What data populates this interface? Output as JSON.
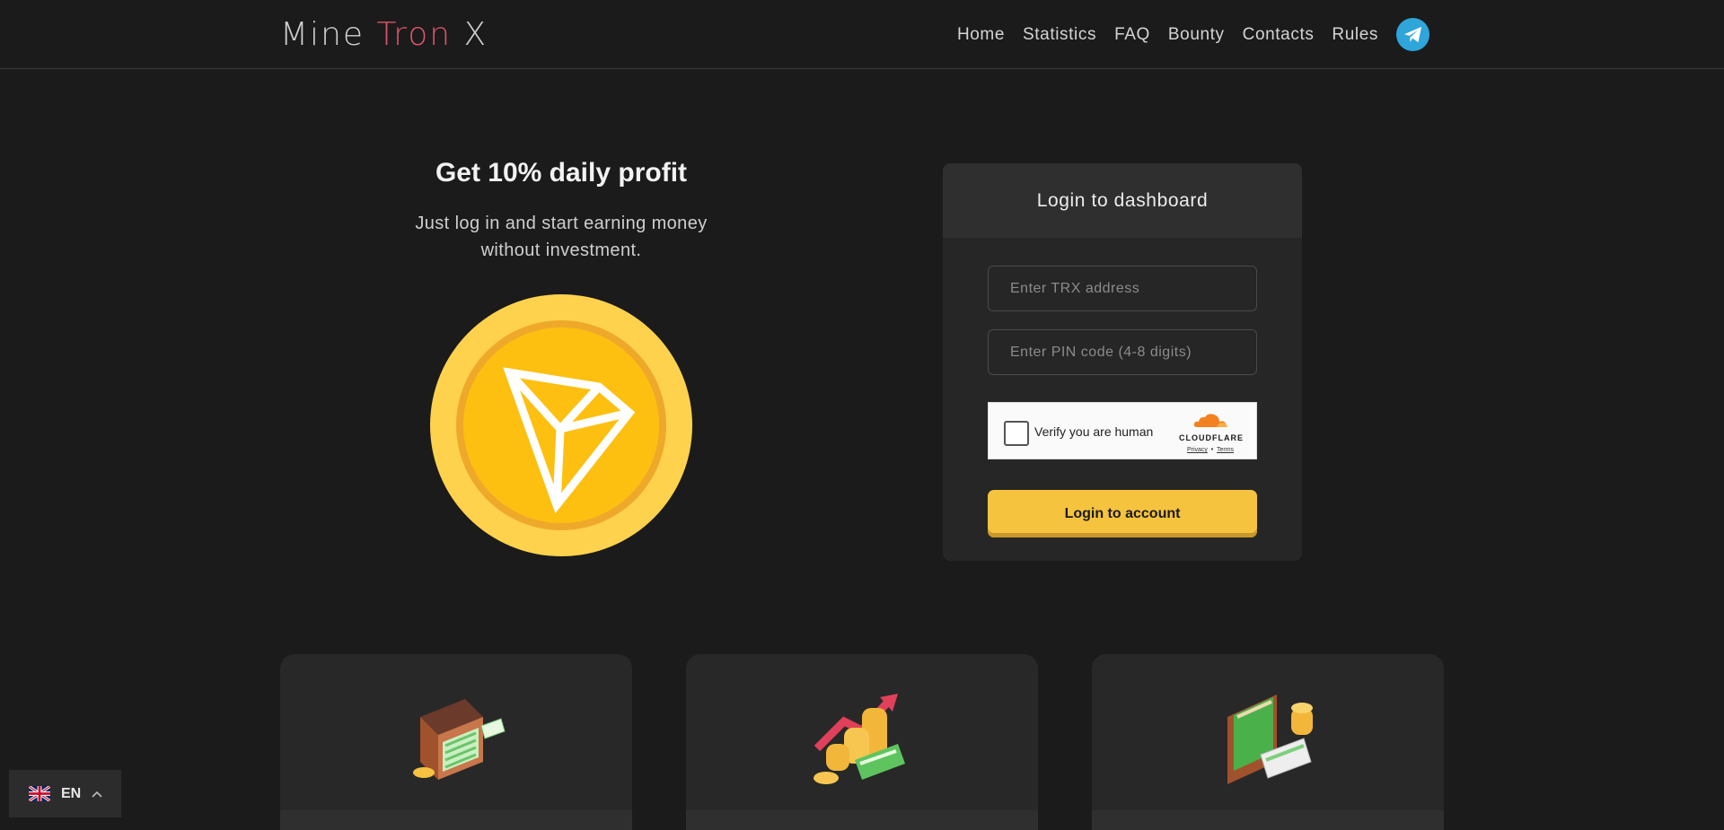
{
  "header": {
    "logo": {
      "part1": "Mine ",
      "part2": "Tron",
      "part3": " X"
    },
    "nav": [
      "Home",
      "Statistics",
      "FAQ",
      "Bounty",
      "Contacts",
      "Rules"
    ]
  },
  "hero": {
    "title": "Get 10% daily profit",
    "subtitle": "Just log in and start earning money without investment."
  },
  "login": {
    "heading": "Login to dashboard",
    "address_placeholder": "Enter TRX address",
    "pin_placeholder": "Enter PIN code (4-8 digits)",
    "captcha_label": "Verify you are human",
    "captcha_brand": "CLOUDFLARE",
    "captcha_privacy": "Privacy",
    "captcha_sep": "•",
    "captcha_terms": "Terms",
    "button": "Login to account"
  },
  "features": [
    {
      "icon": "money-briefcase-icon"
    },
    {
      "icon": "growing-coins-icon"
    },
    {
      "icon": "wallet-cash-icon"
    }
  ],
  "language": {
    "code": "EN",
    "icon": "uk-flag-icon"
  },
  "colors": {
    "accent": "#d8556a",
    "button": "#f6c33f",
    "telegram": "#2ea6da",
    "coin": "#fdc010"
  }
}
